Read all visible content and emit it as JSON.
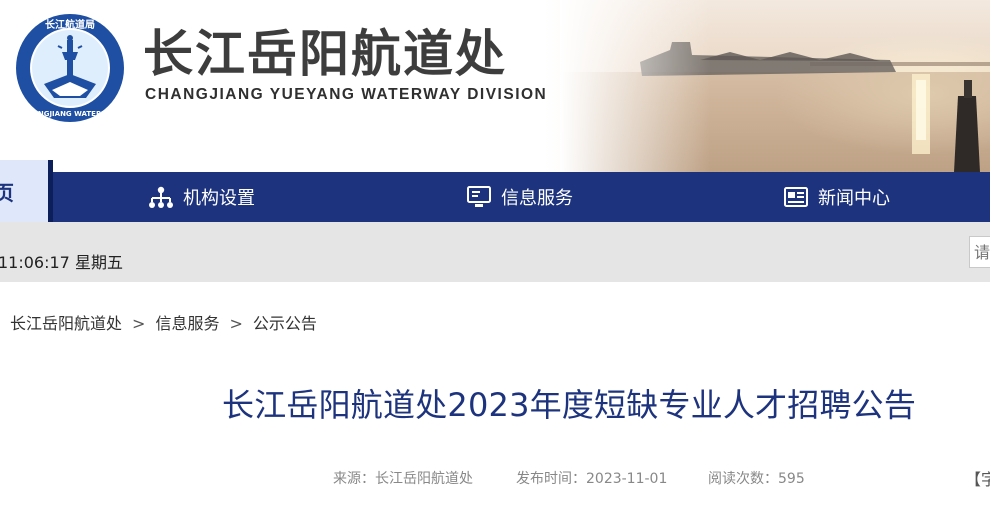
{
  "header": {
    "title": "长江岳阳航道处",
    "subtitle": "CHANGJIANG YUEYANG WATERWAY DIVISION",
    "logo": {
      "top_text": "长江航道局",
      "bottom_text": "CHANGJIANG WATERWAY",
      "ring_color": "#1e4fa3"
    }
  },
  "nav": {
    "home_label": "页",
    "items": [
      {
        "label": "机构设置",
        "icon": "org-chart-icon"
      },
      {
        "label": "信息服务",
        "icon": "monitor-icon"
      },
      {
        "label": "新闻中心",
        "icon": "news-icon"
      }
    ],
    "bg_color": "#1d337e"
  },
  "infobar": {
    "clock": "11:06:17 星期五",
    "search_placeholder": "请"
  },
  "breadcrumb": {
    "prefix": "：",
    "items": [
      "长江岳阳航道处",
      "信息服务",
      "公示公告"
    ],
    "separator": ">"
  },
  "article": {
    "title": "长江岳阳航道处2023年度短缺专业人才招聘公告",
    "source": "来源：长江岳阳航道处",
    "published": "发布时间：2023-11-01",
    "views": "阅读次数：595",
    "font_size_label": "【字"
  }
}
